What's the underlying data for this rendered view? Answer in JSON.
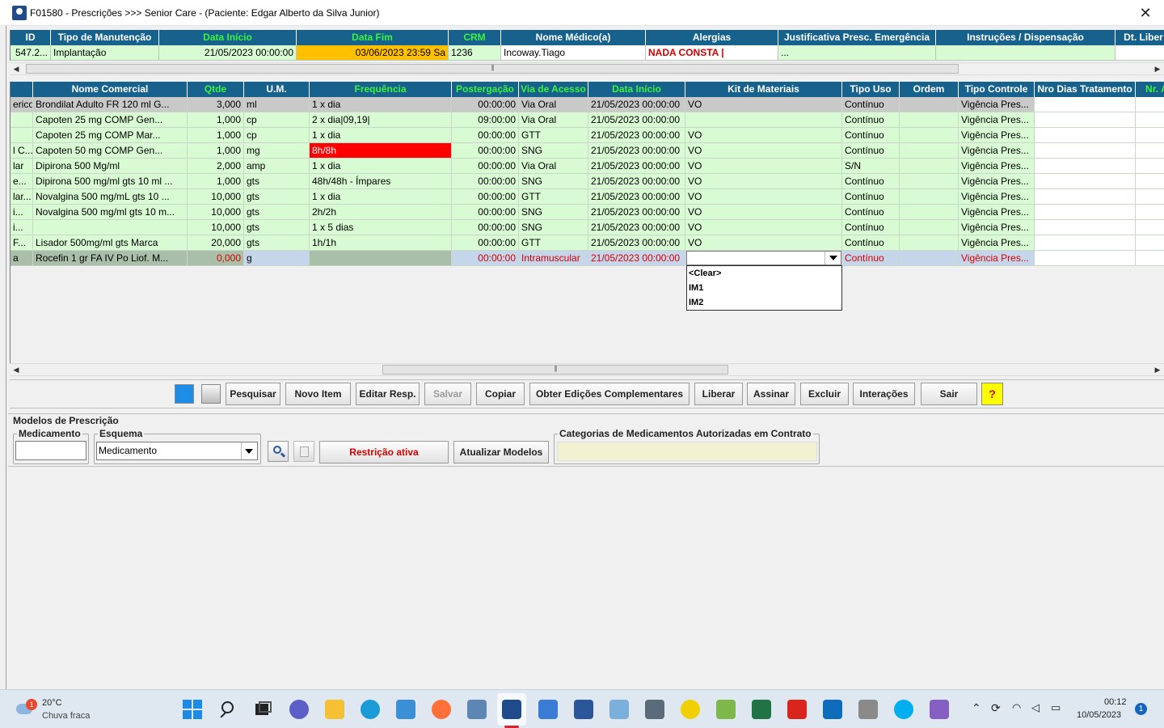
{
  "window": {
    "title": "F01580 - Prescrições >>> Senior Care - (Paciente: Edgar Alberto da Silva Junior)",
    "close_label": "✕"
  },
  "top_grid": {
    "headers": [
      "ID",
      "Tipo de Manutenção",
      "Data Início",
      "Data Fim",
      "CRM",
      "Nome Médico(a)",
      "Alergias",
      "Justificativa Presc. Emergência",
      "Instruções / Dispensação",
      "Dt. Liber"
    ],
    "row": [
      "547.2...",
      "Implantação",
      "21/05/2023 00:00:00",
      "03/06/2023 23:59 Sa",
      "1236",
      "Incoway.Tiago",
      "NADA CONSTA |",
      "...",
      "",
      ""
    ]
  },
  "main_grid": {
    "headers": [
      "",
      "Nome Comercial",
      "Qtde",
      "U.M.",
      "Frequência",
      "Postergação",
      "Via de Acesso",
      "Data Início",
      "Kit de Materiais",
      "Tipo Uso",
      "Ordem",
      "Tipo Controle",
      "Nro Dias Tratamento",
      "Nr. Ap"
    ],
    "rows": [
      [
        "erico",
        "Brondilat  Adulto  FR  120 ml   G...",
        "3,000",
        "ml",
        "1 x dia",
        "00:00:00",
        "Via Oral",
        "21/05/2023 00:00:00",
        "VO",
        "Contínuo",
        "",
        "Vigência Pres...",
        "",
        ""
      ],
      [
        "",
        "Capoten    25 mg  COMP     Gen...",
        "1,000",
        "cp",
        "2 x dia|09,19|",
        "09:00:00",
        "Via Oral",
        "21/05/2023 00:00:00",
        "",
        "Contínuo",
        "",
        "Vigência Pres...",
        "",
        ""
      ],
      [
        "",
        "Capoten    25 mg  COMP     Mar...",
        "1,000",
        "cp",
        "1 x dia",
        "00:00:00",
        "GTT",
        "21/05/2023 00:00:00",
        "VO",
        "Contínuo",
        "",
        "Vigência Pres...",
        "",
        ""
      ],
      [
        "l C...",
        "Capoten    50 mg  COMP     Gen...",
        "1,000",
        "mg",
        "8h/8h",
        "00:00:00",
        "SNG",
        "21/05/2023 00:00:00",
        "VO",
        "Contínuo",
        "",
        "Vigência Pres...",
        "",
        ""
      ],
      [
        "lar",
        "Dipirona  500 Mg/ml",
        "2,000",
        "amp",
        "1 x dia",
        "00:00:00",
        "Via Oral",
        "21/05/2023 00:00:00",
        "VO",
        "S/N",
        "",
        "Vigência Pres...",
        "",
        ""
      ],
      [
        "e...",
        "Dipirona 500 mg/ml   gts 10 ml ...",
        "1,000",
        "gts",
        "48h/48h - Ímpares",
        "00:00:00",
        "SNG",
        "21/05/2023 00:00:00",
        "VO",
        "Contínuo",
        "",
        "Vigência Pres...",
        "",
        ""
      ],
      [
        "lar...",
        "Novalgina 500 mg/mL   gts 10 ...",
        "10,000",
        "gts",
        "1 x dia",
        "00:00:00",
        "GTT",
        "21/05/2023 00:00:00",
        "VO",
        "Contínuo",
        "",
        "Vigência Pres...",
        "",
        ""
      ],
      [
        "i...",
        "Novalgina 500 mg/ml   gts 10 m...",
        "10,000",
        "gts",
        "2h/2h",
        "00:00:00",
        "SNG",
        "21/05/2023 00:00:00",
        "VO",
        "Contínuo",
        "",
        "Vigência Pres...",
        "",
        ""
      ],
      [
        "i...",
        "",
        "10,000",
        "gts",
        "1 x 5 dias",
        "00:00:00",
        "SNG",
        "21/05/2023 00:00:00",
        "VO",
        "Contínuo",
        "",
        "Vigência Pres...",
        "",
        ""
      ],
      [
        " F...",
        "Lisador 500mg/ml  gts Marca",
        "20,000",
        "gts",
        "1h/1h",
        "00:00:00",
        "GTT",
        "21/05/2023 00:00:00",
        "VO",
        "Contínuo",
        "",
        "Vigência Pres...",
        "",
        ""
      ],
      [
        "a",
        "Rocefin   1 gr  FA  IV Po Liof.   M...",
        "0,000",
        "g",
        "",
        "00:00:00",
        "Intramuscular",
        "21/05/2023 00:00:00",
        "",
        "Contínuo",
        "",
        "Vigência Pres...",
        "",
        ""
      ]
    ],
    "dropdown_options": [
      "<Clear>",
      "IM1",
      "IM2"
    ]
  },
  "toolbar": {
    "pesquisar": "Pesquisar",
    "novo_item": "Novo Item",
    "editar_resp": "Editar Resp.",
    "salvar": "Salvar",
    "copiar": "Copiar",
    "obter": "Obter Edições Complementares",
    "liberar": "Liberar",
    "assinar": "Assinar",
    "excluir": "Excluir",
    "interacoes": "Interações",
    "sair": "Sair",
    "help": "?"
  },
  "models": {
    "section_title": "Modelos de Prescrição",
    "medicamento_label": "Medicamento",
    "esquema_label": "Esquema",
    "esquema_value": "Medicamento",
    "restricao": "Restrição ativa",
    "atualizar": "Atualizar Modelos",
    "categorias_label": "Categorias de Medicamentos Autorizadas em Contrato"
  },
  "taskbar": {
    "weather_temp": "20°C",
    "weather_desc": "Chuva fraca",
    "weather_badge": "1",
    "time": "00:12",
    "date": "10/05/2023",
    "notif_count": "1"
  },
  "colors": {
    "header_bg": "#17628c",
    "row_green": "#d9fbd3",
    "highlight_orange": "#ffc000",
    "alert_red": "#ff0000"
  }
}
